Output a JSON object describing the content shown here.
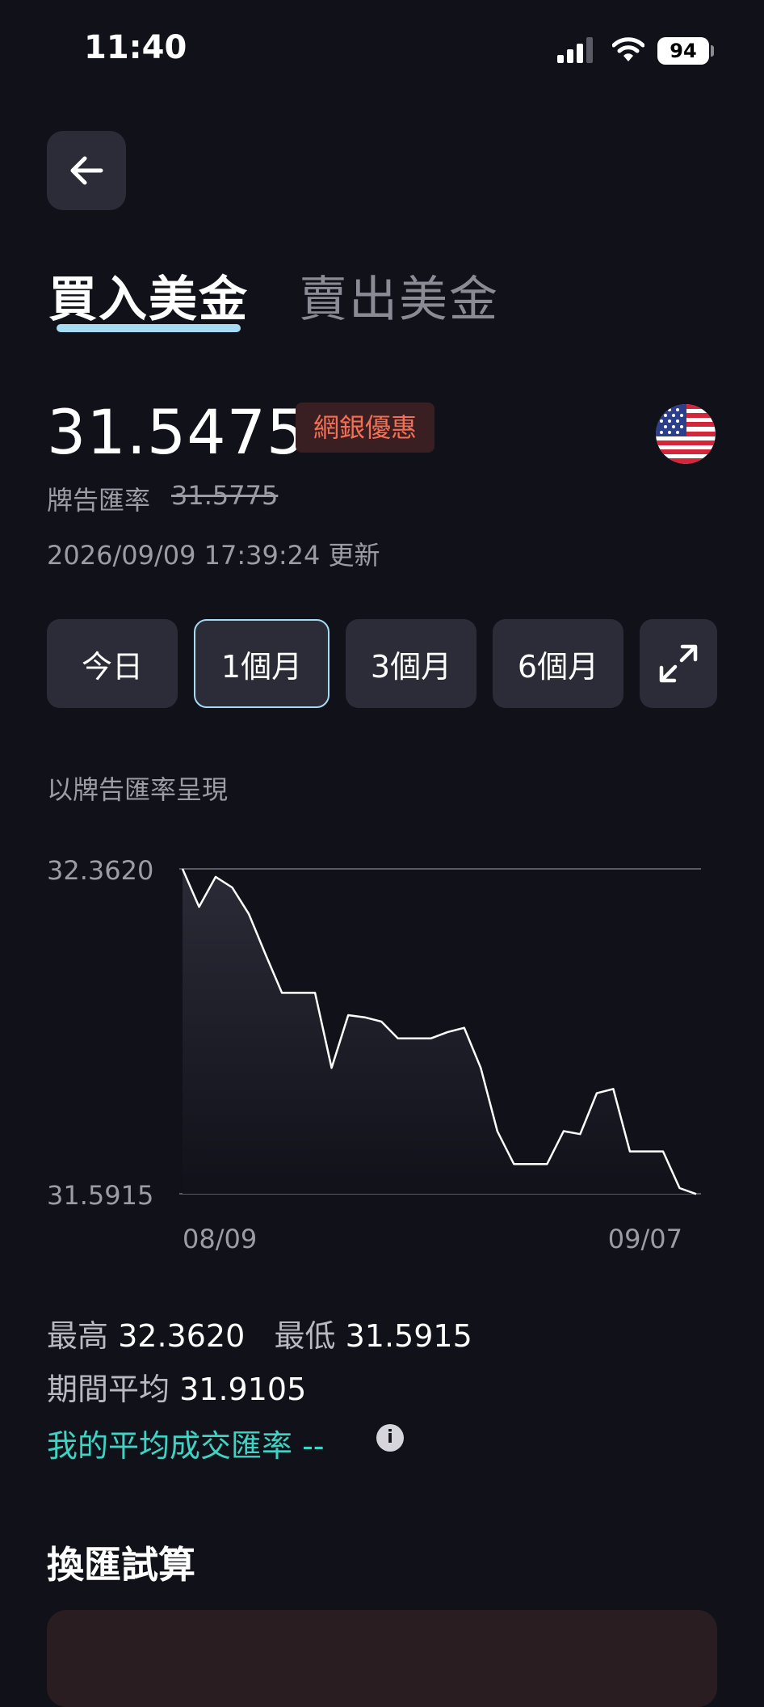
{
  "status_bar": {
    "time": "11:40",
    "battery": "94"
  },
  "header": {
    "back_icon": "arrow-left-icon"
  },
  "tabs": [
    {
      "label": "買入美金",
      "active": true
    },
    {
      "label": "賣出美金",
      "active": false
    }
  ],
  "rate": {
    "value": "31.5475",
    "badge": "網銀優惠",
    "board_label": "牌告匯率",
    "board_value": "31.5775",
    "updated": "2026/09/09 17:39:24 更新",
    "flag_icon": "us-flag-icon"
  },
  "periods": [
    {
      "label": "今日",
      "selected": false
    },
    {
      "label": "1個月",
      "selected": true
    },
    {
      "label": "3個月",
      "selected": false
    },
    {
      "label": "6個月",
      "selected": false
    }
  ],
  "expand_icon": "expand-icon",
  "chart_note": "以牌告匯率呈現",
  "chart_data": {
    "type": "area",
    "x_labels": [
      "08/09",
      "09/07"
    ],
    "ylim": [
      31.5915,
      32.362
    ],
    "y_ticks": [
      "32.3620",
      "31.5915"
    ],
    "values": [
      32.362,
      32.272,
      32.343,
      32.318,
      32.255,
      32.16,
      32.068,
      32.068,
      32.068,
      31.89,
      32.015,
      32.01,
      32.0,
      31.96,
      31.96,
      31.96,
      31.975,
      31.985,
      31.89,
      31.74,
      31.662,
      31.662,
      31.662,
      31.74,
      31.733,
      31.83,
      31.84,
      31.692,
      31.692,
      31.692,
      31.605,
      31.591
    ],
    "colors": {
      "line": "#ffffff",
      "grid": "#5a5a64",
      "fill_top": "#2a2b36"
    }
  },
  "stats": {
    "high_label": "最高",
    "high_value": "32.3620",
    "low_label": "最低",
    "low_value": "31.5915",
    "avg_label": "期間平均",
    "avg_value": "31.9105",
    "my_avg": "我的平均成交匯率 --",
    "info_icon": "i"
  },
  "section_title": "換匯試算"
}
